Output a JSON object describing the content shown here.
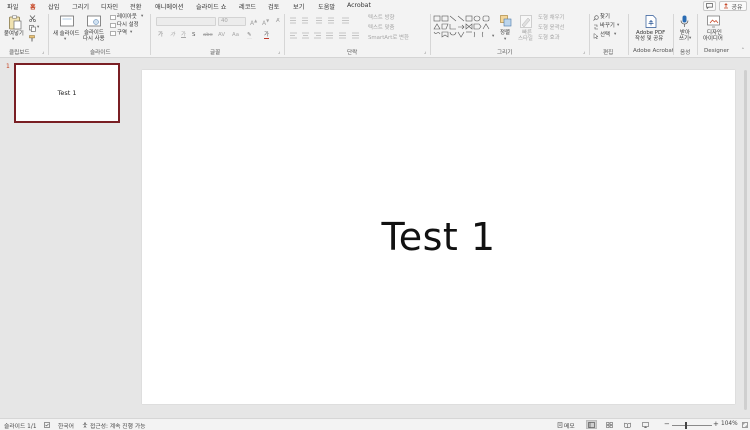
{
  "tabs": [
    {
      "label": "파일",
      "active": false
    },
    {
      "label": "홈",
      "active": true
    },
    {
      "label": "삽입",
      "active": false
    },
    {
      "label": "그리기",
      "active": false
    },
    {
      "label": "디자인",
      "active": false
    },
    {
      "label": "전환",
      "active": false
    },
    {
      "label": "애니메이션",
      "active": false
    },
    {
      "label": "슬라이드 쇼",
      "active": false
    },
    {
      "label": "레코드",
      "active": false
    },
    {
      "label": "검토",
      "active": false
    },
    {
      "label": "보기",
      "active": false
    },
    {
      "label": "도움말",
      "active": false
    },
    {
      "label": "Acrobat",
      "active": false
    }
  ],
  "window": {
    "share_label": "공유"
  },
  "ribbon": {
    "clipboard": {
      "label": "클립보드",
      "paste_label": "붙여넣기"
    },
    "slides": {
      "label": "슬라이드",
      "new_slide_label": "새 슬라이드",
      "reuse_label_1": "슬라이드",
      "reuse_label_2": "다시 사용",
      "layout_label": "레이아웃",
      "reset_label": "다시 설정",
      "section_label": "구역"
    },
    "font": {
      "label": "글꼴",
      "size_value": "40"
    },
    "paragraph": {
      "label": "단락",
      "text_direction_label": "텍스트 방향",
      "align_text_label": "텍스트 맞춤",
      "smartart_label": "SmartArt로 변환"
    },
    "drawing": {
      "label": "그리기",
      "arrange_label": "정렬",
      "quick_styles_label_1": "빠른",
      "quick_styles_label_2": "스타일",
      "fill_label": "도형 채우기",
      "outline_label": "도형 윤곽선",
      "effects_label": "도형 효과"
    },
    "editing": {
      "label": "편집",
      "find_label": "찾기",
      "replace_label": "바꾸기",
      "select_label": "선택"
    },
    "acrobat": {
      "label": "Adobe Acrobat",
      "btn_line1": "Adobe PDF",
      "btn_line2": "작성 및 공유"
    },
    "voice": {
      "label": "음성",
      "btn_line1": "받아",
      "btn_line2": "쓰기"
    },
    "designer": {
      "label": "Designer",
      "btn_line1": "디자인",
      "btn_line2": "아이디어"
    }
  },
  "thumbnails": [
    {
      "number": "1",
      "text": "Test 1"
    }
  ],
  "slide": {
    "title": "Test 1"
  },
  "status": {
    "slide_info": "슬라이드 1/1",
    "language": "한국어",
    "accessibility": "접근성: 계속 진행 가능",
    "notes_label": "메모",
    "zoom": "104%"
  },
  "colors": {
    "accent": "#c43e1c",
    "thumbnail_border": "#7a1f24"
  }
}
